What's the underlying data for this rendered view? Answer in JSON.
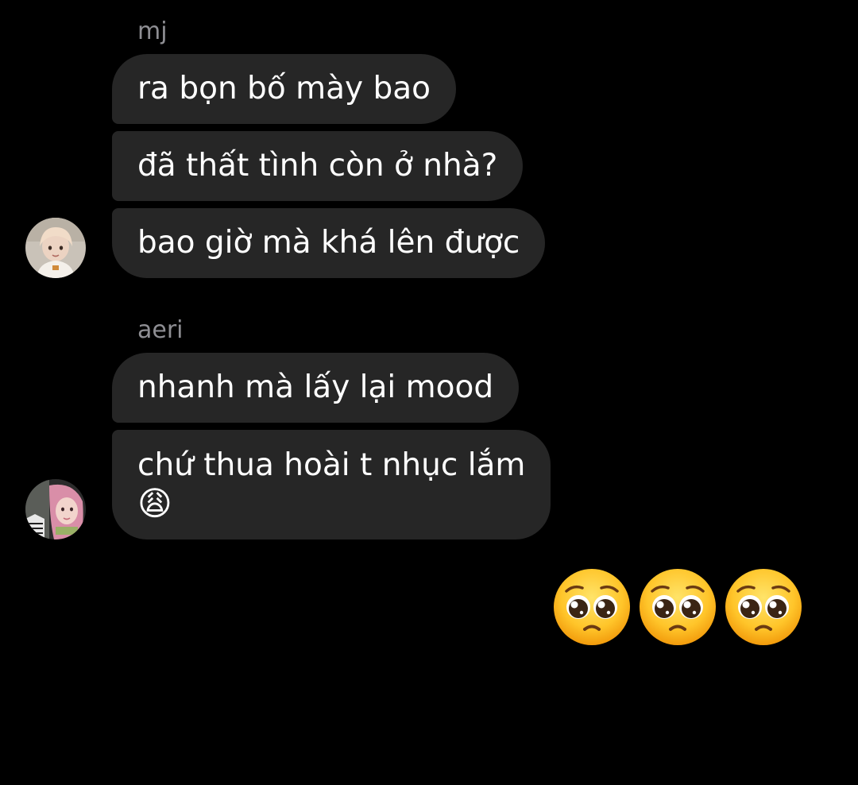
{
  "conversation": {
    "groups": [
      {
        "sender": "mj",
        "messages": [
          "ra bọn bố mày bao",
          "đã thất tình còn ở nhà?",
          "bao giờ mà khá lên được"
        ]
      },
      {
        "sender": "aeri",
        "messages": [
          "nhanh mà lấy lại mood",
          "chứ thua hoài t nhục lắm"
        ],
        "emoji": "😩"
      }
    ],
    "own_message": {
      "emoji_count": 3,
      "emoji_icon": "pleading-face-icon"
    }
  },
  "colors": {
    "background": "#000000",
    "bubble": "#262626",
    "sender_name": "#8e8e93",
    "text": "#ffffff"
  }
}
